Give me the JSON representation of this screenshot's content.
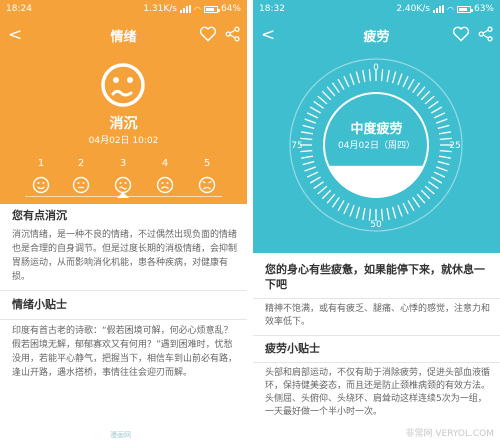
{
  "left": {
    "status": {
      "time": "18:24",
      "network": "1.31K/s",
      "battery": "64%"
    },
    "title": "情绪",
    "mood": {
      "name": "消沉",
      "date": "04月02日 10:02"
    },
    "scale": {
      "labels": [
        "1",
        "2",
        "3",
        "4",
        "5"
      ],
      "selected": 3
    },
    "sections": [
      {
        "heading": "您有点消沉",
        "text": "消沉情绪，是一种不良的情绪，不过偶然出现负面的情绪也是合理的自身调节。但是过度长期的消极情绪，会抑制胃肠运动，从而影响消化机能，患各种疾病，对健康有损。"
      },
      {
        "heading": "情绪小贴士",
        "text": "印度有首古老的诗歌：“假若困境可解，何必心烦意乱？假若困境无解，郁郁寡欢又有何用？”遇到困难时，忧愁没用，若能平心静气，把握当下，相信车到山前必有路，逢山开路，遇水搭桥，事情往往会迎刃而解。"
      }
    ],
    "colors": {
      "accent": "#f5a23a"
    }
  },
  "right": {
    "status": {
      "time": "18:32",
      "network": "2.40K/s",
      "battery": "63%"
    },
    "title": "疲劳",
    "gauge": {
      "title": "中度疲劳",
      "date": "04月02日（周四）",
      "ticks": [
        "0",
        "25",
        "50",
        "75"
      ],
      "level": 0.3
    },
    "sections": [
      {
        "heading": "您的身心有些疲惫，如果能停下来，就休息一下吧",
        "text": "精神不饱满，或有有疲乏、腿痛、心悸的感觉，注意力和效率低下。"
      },
      {
        "heading": "疲劳小贴士",
        "text": "头部和肩部运动，不仅有助于消除疲劳，促进头部血液循环，保持健美姿态，而且还是防止颈椎病颈的有效方法。头侧屈、头俯仰、头绕环、肩耸动这样连续5次为一组，一天最好做一个半小时一次。"
      }
    ],
    "colors": {
      "accent": "#3fbecf"
    }
  },
  "watermark": {
    "text": "非常网 VERYOL.COM",
    "mark": "漫画网"
  }
}
